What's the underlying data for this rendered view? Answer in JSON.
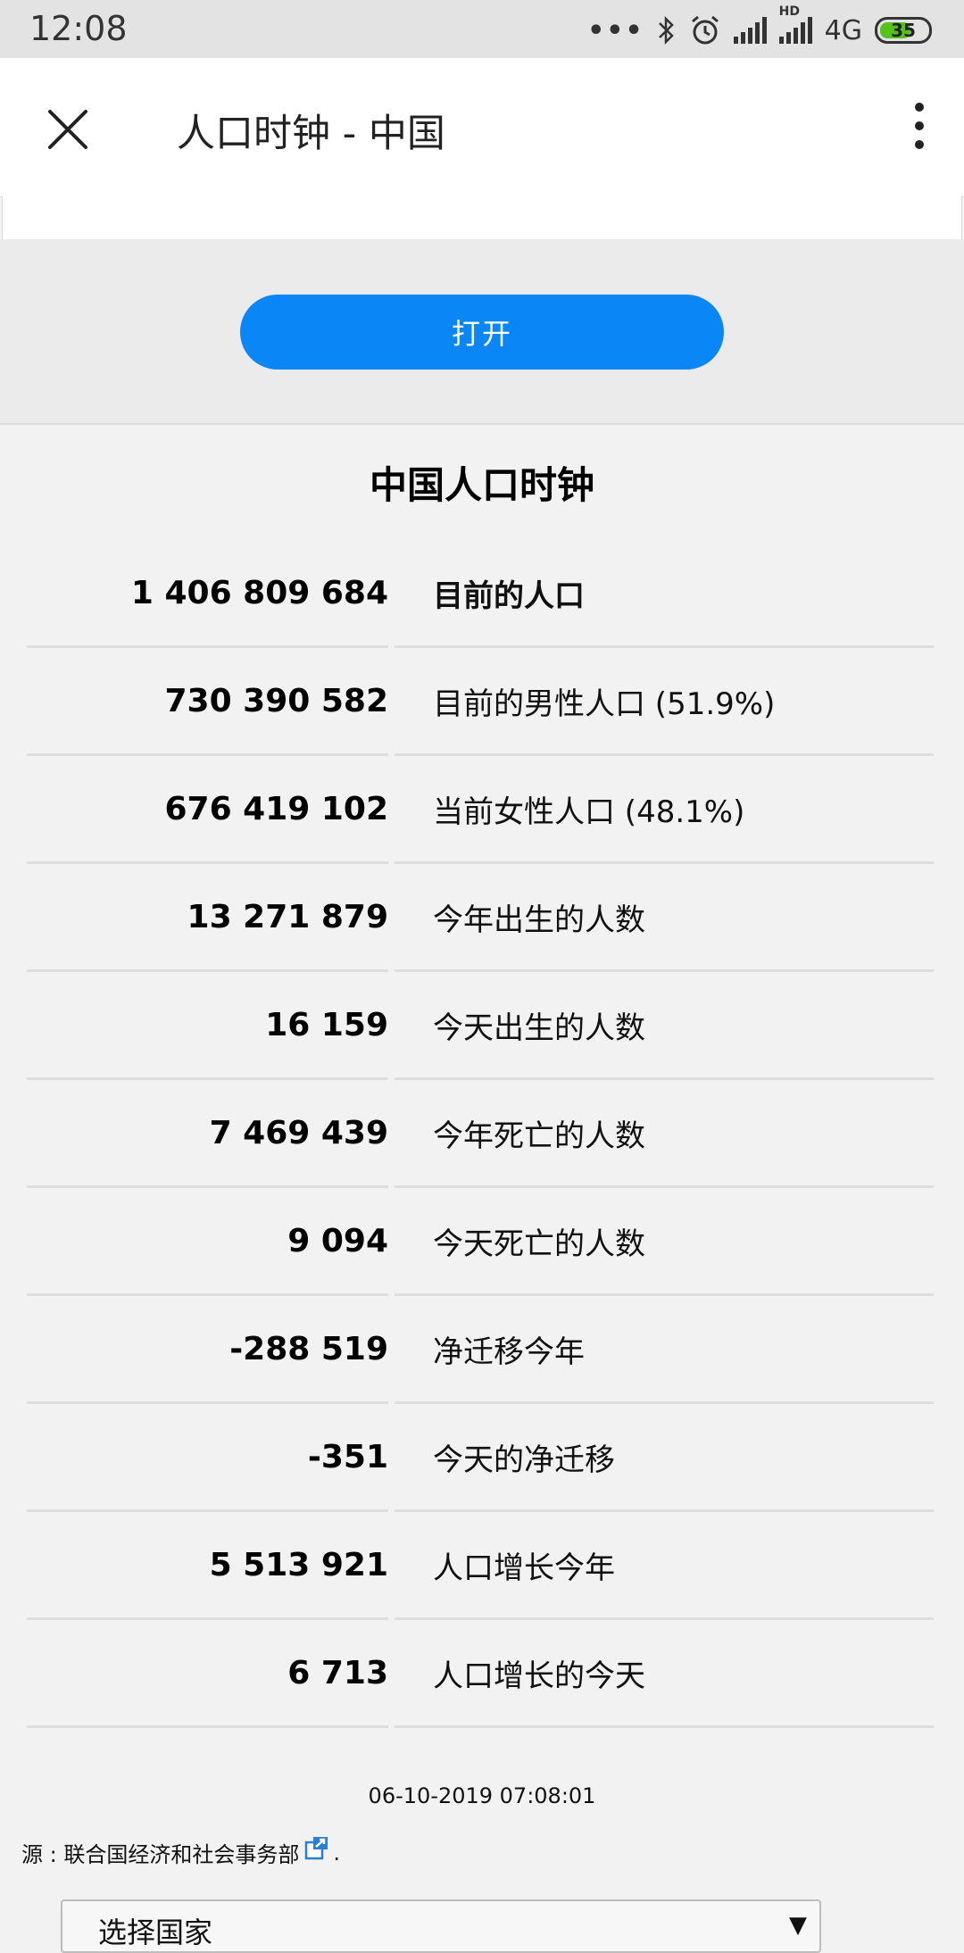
{
  "status_bar": {
    "time": "12:08",
    "network": "4G",
    "hd_label": "HD",
    "battery": "35",
    "battery_color": "#55c11b"
  },
  "title_bar": {
    "title": "人口时钟 - 中国",
    "close_icon": "close-icon",
    "more_icon": "more-vert-icon"
  },
  "open_button": {
    "label": "打开",
    "color": "#0a86f7"
  },
  "heading": "中国人口时钟",
  "stats": [
    {
      "value": "1 406 809 684",
      "label": "目前的人口"
    },
    {
      "value": "730 390 582",
      "label": "目前的男性人口 (51.9%)"
    },
    {
      "value": "676 419 102",
      "label": "当前女性人口 (48.1%)"
    },
    {
      "value": "13 271 879",
      "label": "今年出生的人数"
    },
    {
      "value": "16 159",
      "label": "今天出生的人数"
    },
    {
      "value": "7 469 439",
      "label": "今年死亡的人数"
    },
    {
      "value": "9 094",
      "label": "今天死亡的人数"
    },
    {
      "value": "-288 519",
      "label": "净迁移今年"
    },
    {
      "value": "-351",
      "label": "今天的净迁移"
    },
    {
      "value": "5 513 921",
      "label": "人口增长今年"
    },
    {
      "value": "6 713",
      "label": "人口增长的今天"
    }
  ],
  "timestamp": "06-10-2019 07:08:01",
  "source": {
    "text": "源 : 联合国经济和社会事务部",
    "suffix": "."
  },
  "country_select": {
    "value": "选择国家",
    "arrow": "▼"
  }
}
